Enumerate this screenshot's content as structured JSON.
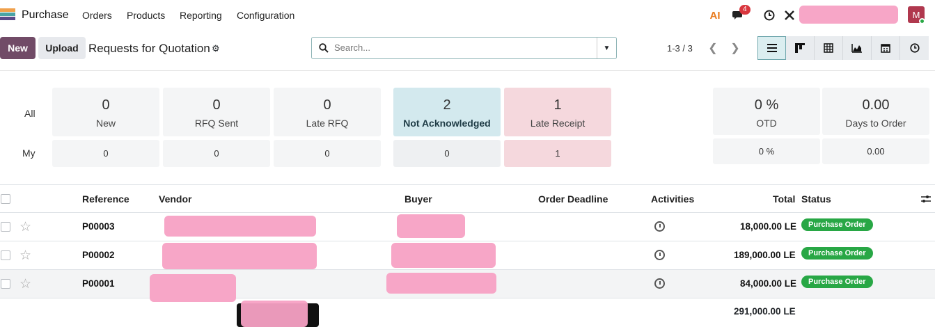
{
  "nav": {
    "brand": "Purchase",
    "menus": [
      "Orders",
      "Products",
      "Reporting",
      "Configuration"
    ],
    "ai_label": "AI",
    "chat_badge": "4",
    "avatar_initial": "M"
  },
  "control": {
    "new_label": "New",
    "upload_label": "Upload",
    "title": "Requests for Quotation",
    "search_placeholder": "Search...",
    "pager": "1-3 / 3"
  },
  "dashboard": {
    "row_labels": [
      "All",
      "My"
    ],
    "cards": [
      {
        "all": "0",
        "label": "New",
        "my": "0"
      },
      {
        "all": "0",
        "label": "RFQ Sent",
        "my": "0"
      },
      {
        "all": "0",
        "label": "Late RFQ",
        "my": "0"
      },
      {
        "all": "2",
        "label": "Not Acknowledged",
        "my": "0"
      },
      {
        "all": "1",
        "label": "Late Receipt",
        "my": "1"
      },
      {
        "all": "0 %",
        "label": "OTD",
        "my": "0 %"
      },
      {
        "all": "0.00",
        "label": "Days to Order",
        "my": "0.00"
      }
    ]
  },
  "table": {
    "headers": {
      "reference": "Reference",
      "vendor": "Vendor",
      "buyer": "Buyer",
      "deadline": "Order Deadline",
      "activities": "Activities",
      "total": "Total",
      "status": "Status"
    },
    "rows": [
      {
        "reference": "P00003",
        "total": "18,000.00 LE",
        "status": "Purchase Order"
      },
      {
        "reference": "P00002",
        "total": "189,000.00 LE",
        "status": "Purchase Order"
      },
      {
        "reference": "P00001",
        "total": "84,000.00 LE",
        "status": "Purchase Order"
      }
    ],
    "grand_total": "291,000.00 LE"
  },
  "colors": {
    "primary": "#714b67",
    "status_green": "#28a745",
    "teal_card": "#d3e9ee",
    "pink_card": "#f5d8dd"
  },
  "icons": [
    "app-icon",
    "chat-icon",
    "clock-icon",
    "tools-icon",
    "gear-icon",
    "search-icon",
    "caret-down-icon",
    "chevron-left-icon",
    "chevron-right-icon",
    "list-view-icon",
    "kanban-view-icon",
    "pivot-view-icon",
    "graph-view-icon",
    "calendar-view-icon",
    "activity-view-icon",
    "star-icon",
    "optional-columns-icon"
  ]
}
